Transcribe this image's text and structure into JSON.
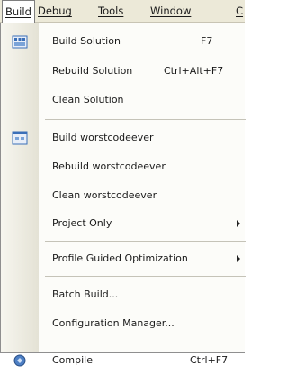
{
  "menubar": {
    "items": [
      {
        "label": "Build"
      },
      {
        "label": "Debug"
      },
      {
        "label": "Tools"
      },
      {
        "label": "Window"
      },
      {
        "label": "C"
      }
    ]
  },
  "menu": {
    "build_solution": {
      "label": "Build Solution",
      "shortcut": "F7",
      "icon": "build-solution-icon"
    },
    "rebuild_solution": {
      "label": "Rebuild Solution",
      "shortcut": "Ctrl+Alt+F7"
    },
    "clean_solution": {
      "label": "Clean Solution"
    },
    "build_project": {
      "label": "Build worstcodeever",
      "icon": "build-project-icon"
    },
    "rebuild_project": {
      "label": "Rebuild worstcodeever"
    },
    "clean_project": {
      "label": "Clean worstcodeever"
    },
    "project_only": {
      "label": "Project Only"
    },
    "pgo": {
      "label": "Profile Guided Optimization"
    },
    "batch_build": {
      "label": "Batch Build..."
    },
    "config_manager": {
      "label": "Configuration Manager..."
    },
    "compile": {
      "label": "Compile",
      "shortcut": "Ctrl+F7",
      "icon": "compile-icon"
    }
  }
}
